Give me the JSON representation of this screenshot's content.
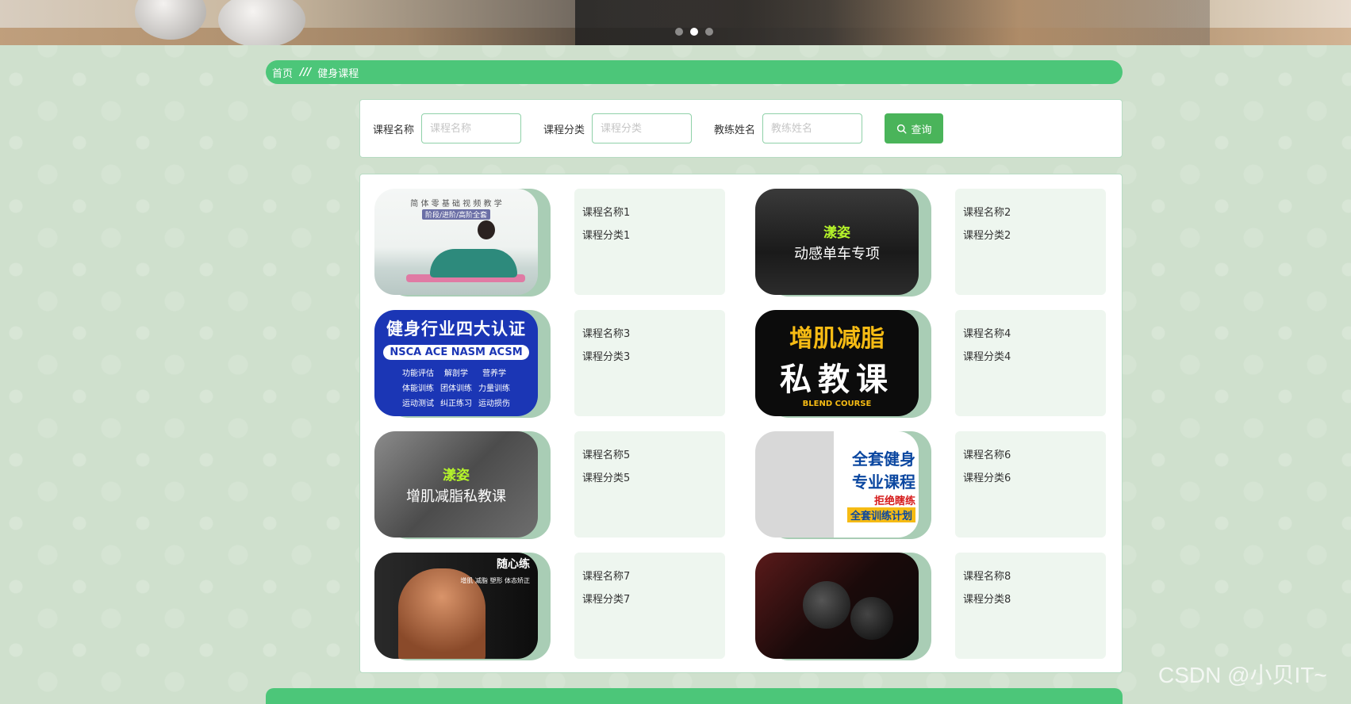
{
  "banner": {
    "carousel": {
      "count": 3,
      "active_index": 1
    }
  },
  "breadcrumb": {
    "home": "首页",
    "separator": "///",
    "current": "健身课程"
  },
  "search": {
    "fields": [
      {
        "label": "课程名称",
        "placeholder": "课程名称"
      },
      {
        "label": "课程分类",
        "placeholder": "课程分类"
      },
      {
        "label": "教练姓名",
        "placeholder": "教练姓名"
      }
    ],
    "button_label": "查询"
  },
  "courses": [
    {
      "name": "课程名称1",
      "category": "课程分类1",
      "image_text": [
        "简  体  零  基  础  视  频  教  学",
        "阶段/进阶/高阶全套"
      ]
    },
    {
      "name": "课程名称2",
      "category": "课程分类2",
      "image_text": [
        "漾姿",
        "动感单车专项"
      ]
    },
    {
      "name": "课程名称3",
      "category": "课程分类3",
      "image_text": [
        "健身行业四大认证",
        "NSCA  ACE  NASM  ACSM",
        "功能评估",
        "解剖学",
        "营养学",
        "体能训练",
        "团体训练",
        "力量训练",
        "运动测试",
        "纠正练习",
        "运动损伤"
      ]
    },
    {
      "name": "课程名称4",
      "category": "课程分类4",
      "image_text": [
        "增肌减脂",
        "私教课",
        "BLEND COURSE"
      ]
    },
    {
      "name": "课程名称5",
      "category": "课程分类5",
      "image_text": [
        "漾姿",
        "增肌减脂私教课"
      ]
    },
    {
      "name": "课程名称6",
      "category": "课程分类6",
      "image_text": [
        "全套健身",
        "专业课程",
        "拒绝瞎练",
        "全套训练计划"
      ]
    },
    {
      "name": "课程名称7",
      "category": "课程分类7",
      "image_text": [
        "随心练",
        "增肌  减脂  塑形  体态矫正"
      ]
    },
    {
      "name": "课程名称8",
      "category": "课程分类8",
      "image_text": []
    }
  ],
  "watermark": "CSDN @小贝IT~",
  "colors": {
    "accent_green": "#4cc679",
    "button_green": "#4ab45a",
    "page_bg": "#cfe0cd"
  }
}
